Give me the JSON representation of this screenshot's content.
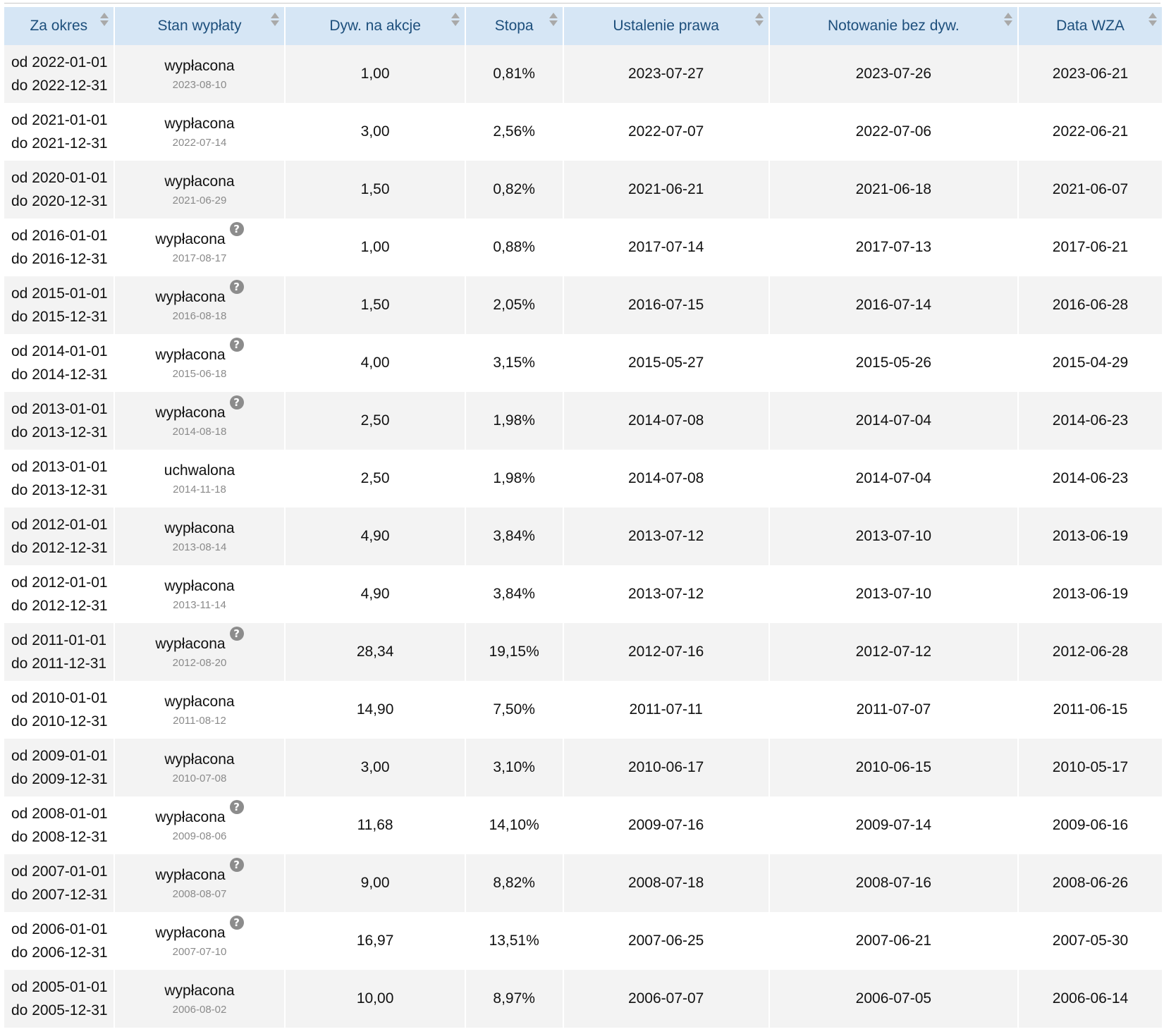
{
  "table": {
    "columns": [
      "Za okres",
      "Stan wypłaty",
      "Dyw. na akcje",
      "Stopa",
      "Ustalenie prawa",
      "Notowanie bez dyw.",
      "Data WZA"
    ],
    "rows": [
      {
        "from": "od 2022-01-01",
        "to": "do 2022-12-31",
        "status": "wypłacona",
        "status_date": "2023-08-10",
        "help": false,
        "dividend": "1,00",
        "rate": "0,81%",
        "record_date": "2023-07-27",
        "ex_date": "2023-07-26",
        "agm_date": "2023-06-21"
      },
      {
        "from": "od 2021-01-01",
        "to": "do 2021-12-31",
        "status": "wypłacona",
        "status_date": "2022-07-14",
        "help": false,
        "dividend": "3,00",
        "rate": "2,56%",
        "record_date": "2022-07-07",
        "ex_date": "2022-07-06",
        "agm_date": "2022-06-21"
      },
      {
        "from": "od 2020-01-01",
        "to": "do 2020-12-31",
        "status": "wypłacona",
        "status_date": "2021-06-29",
        "help": false,
        "dividend": "1,50",
        "rate": "0,82%",
        "record_date": "2021-06-21",
        "ex_date": "2021-06-18",
        "agm_date": "2021-06-07"
      },
      {
        "from": "od 2016-01-01",
        "to": "do 2016-12-31",
        "status": "wypłacona",
        "status_date": "2017-08-17",
        "help": true,
        "dividend": "1,00",
        "rate": "0,88%",
        "record_date": "2017-07-14",
        "ex_date": "2017-07-13",
        "agm_date": "2017-06-21"
      },
      {
        "from": "od 2015-01-01",
        "to": "do 2015-12-31",
        "status": "wypłacona",
        "status_date": "2016-08-18",
        "help": true,
        "dividend": "1,50",
        "rate": "2,05%",
        "record_date": "2016-07-15",
        "ex_date": "2016-07-14",
        "agm_date": "2016-06-28"
      },
      {
        "from": "od 2014-01-01",
        "to": "do 2014-12-31",
        "status": "wypłacona",
        "status_date": "2015-06-18",
        "help": true,
        "dividend": "4,00",
        "rate": "3,15%",
        "record_date": "2015-05-27",
        "ex_date": "2015-05-26",
        "agm_date": "2015-04-29"
      },
      {
        "from": "od 2013-01-01",
        "to": "do 2013-12-31",
        "status": "wypłacona",
        "status_date": "2014-08-18",
        "help": true,
        "dividend": "2,50",
        "rate": "1,98%",
        "record_date": "2014-07-08",
        "ex_date": "2014-07-04",
        "agm_date": "2014-06-23"
      },
      {
        "from": "od 2013-01-01",
        "to": "do 2013-12-31",
        "status": "uchwalona",
        "status_date": "2014-11-18",
        "help": false,
        "dividend": "2,50",
        "rate": "1,98%",
        "record_date": "2014-07-08",
        "ex_date": "2014-07-04",
        "agm_date": "2014-06-23"
      },
      {
        "from": "od 2012-01-01",
        "to": "do 2012-12-31",
        "status": "wypłacona",
        "status_date": "2013-08-14",
        "help": false,
        "dividend": "4,90",
        "rate": "3,84%",
        "record_date": "2013-07-12",
        "ex_date": "2013-07-10",
        "agm_date": "2013-06-19"
      },
      {
        "from": "od 2012-01-01",
        "to": "do 2012-12-31",
        "status": "wypłacona",
        "status_date": "2013-11-14",
        "help": false,
        "dividend": "4,90",
        "rate": "3,84%",
        "record_date": "2013-07-12",
        "ex_date": "2013-07-10",
        "agm_date": "2013-06-19"
      },
      {
        "from": "od 2011-01-01",
        "to": "do 2011-12-31",
        "status": "wypłacona",
        "status_date": "2012-08-20",
        "help": true,
        "dividend": "28,34",
        "rate": "19,15%",
        "record_date": "2012-07-16",
        "ex_date": "2012-07-12",
        "agm_date": "2012-06-28"
      },
      {
        "from": "od 2010-01-01",
        "to": "do 2010-12-31",
        "status": "wypłacona",
        "status_date": "2011-08-12",
        "help": false,
        "dividend": "14,90",
        "rate": "7,50%",
        "record_date": "2011-07-11",
        "ex_date": "2011-07-07",
        "agm_date": "2011-06-15"
      },
      {
        "from": "od 2009-01-01",
        "to": "do 2009-12-31",
        "status": "wypłacona",
        "status_date": "2010-07-08",
        "help": false,
        "dividend": "3,00",
        "rate": "3,10%",
        "record_date": "2010-06-17",
        "ex_date": "2010-06-15",
        "agm_date": "2010-05-17"
      },
      {
        "from": "od 2008-01-01",
        "to": "do 2008-12-31",
        "status": "wypłacona",
        "status_date": "2009-08-06",
        "help": true,
        "dividend": "11,68",
        "rate": "14,10%",
        "record_date": "2009-07-16",
        "ex_date": "2009-07-14",
        "agm_date": "2009-06-16"
      },
      {
        "from": "od 2007-01-01",
        "to": "do 2007-12-31",
        "status": "wypłacona",
        "status_date": "2008-08-07",
        "help": true,
        "dividend": "9,00",
        "rate": "8,82%",
        "record_date": "2008-07-18",
        "ex_date": "2008-07-16",
        "agm_date": "2008-06-26"
      },
      {
        "from": "od 2006-01-01",
        "to": "do 2006-12-31",
        "status": "wypłacona",
        "status_date": "2007-07-10",
        "help": true,
        "dividend": "16,97",
        "rate": "13,51%",
        "record_date": "2007-06-25",
        "ex_date": "2007-06-21",
        "agm_date": "2007-05-30"
      },
      {
        "from": "od 2005-01-01",
        "to": "do 2005-12-31",
        "status": "wypłacona",
        "status_date": "2006-08-02",
        "help": false,
        "dividend": "10,00",
        "rate": "8,97%",
        "record_date": "2006-07-07",
        "ex_date": "2006-07-05",
        "agm_date": "2006-06-14"
      }
    ],
    "help_icon": "question-circle-icon",
    "sort_icon": "sort-arrows-icon",
    "colors": {
      "header_bg": "#d6e6f5",
      "header_text": "#1d4f7c",
      "row_odd": "#f3f3f3",
      "row_even": "#ffffff",
      "muted_text": "#8a8a8a"
    }
  }
}
